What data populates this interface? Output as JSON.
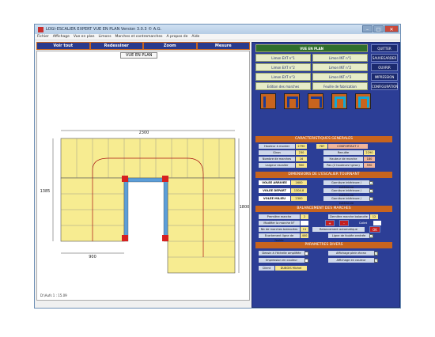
{
  "window": {
    "title": "LOGI-ESCALIER EXPERT     VUE EN PLAN     Version 3.0.3   ©   A.G.",
    "min": "–",
    "max": "□",
    "close": "✕"
  },
  "menu": [
    "Fichier",
    "Affichage",
    "Vue en plan",
    "Limons",
    "Marches et contremarches",
    "A propos de",
    "Aide"
  ],
  "toolbar": {
    "voir_tout": "Voir tout",
    "redessiner": "Redessiner",
    "zoom": "Zoom",
    "mesure": "Mesure"
  },
  "drawing": {
    "view_title": "VUE EN PLAN",
    "dim_top": "2300",
    "dim_left": "1385",
    "dim_right": "1800",
    "dim_bottom": "900",
    "status": "D:\\Aufs    1 : 15.09"
  },
  "panel": {
    "vue_en_plan": "VUE EN PLAN",
    "limon_ext_1": "Limon EXT n°1",
    "limon_int_1": "Limon INT n°1",
    "limon_ext_2": "Limon EXT n°2",
    "limon_int_2": "Limon INT n°2",
    "limon_ext_3": "Limon EXT n°3",
    "limon_int_3": "Limon INT n°3",
    "edition_marches": "Edition des marches",
    "feuille_fabrication": "Feuille de fabrication",
    "quitter": "QUITTER",
    "sauvegarder": "SAUVEGARDER",
    "ouvrir": "OUVRIR",
    "impression": "IMPRESSION",
    "configuration": "CONFIGURATION"
  },
  "caracteristiques": {
    "title": "CARACTERISTIQUES GENERALES",
    "hauteur_label": "Hauteur à monter",
    "hauteur_val": "2790",
    "ratio": "787",
    "confort": "CONFORTAUT 2",
    "giron_label": "Giron",
    "giron_val": "230",
    "recul_label": "Reculée",
    "recul_val": "2290",
    "nb_marches_label": "Nombre de marches",
    "nb_marches_val": "16",
    "haut_marche_label": "Hauteur de marche",
    "haut_marche_val": "180",
    "largeur_label": "Largeur escalier",
    "largeur_val": "900",
    "pas_label": "Pas (2 hauteurs+giron)",
    "pas_val": "590"
  },
  "dimensions": {
    "title": "DIMENSIONS DE L'ESCALIER TOURNANT",
    "volee_arrivee_label": "VOLEE ARRIVEE",
    "volee_arrivee_val": "1600",
    "volee_depart_label": "VOLEE DEPART",
    "volee_depart_val": "1304.8",
    "volee_milieu_label": "VOLEE MILIEU",
    "volee_milieu_val": "2300",
    "garniture": "Garniture intérieure / extérieure"
  },
  "balancement": {
    "title": "BALANCEMENT DES MARCHES",
    "premiere_label": "Première marche balancée",
    "premiere_val": "2",
    "derniere_label": "Dernière marche balancée",
    "derniere_val": "12",
    "modifier_label": "Modifier la marche N°",
    "modifier_val": "",
    "plus": "+",
    "moins": "-",
    "collet": "Collet",
    "nb_marches_label": "Nb de marches balancées",
    "nb_marches_val": "11",
    "auto_label": "Balancement automatique",
    "ok": "OK",
    "ecart_label": "Ecartement ligne de foulée",
    "ecart_val": "400",
    "ligne_label": "Ligne de foulée centrée"
  },
  "parametres": {
    "title": "PARAMETRES DIVERS",
    "dessin_label": "Dessin à l'échelle amplifiée",
    "affichage_label": "Affichage plein écran",
    "impression_label": "Impression en couleur",
    "affichage_couleur_label": "Affichage en couleur",
    "client_label": "Client",
    "client_val": "DUBOIS Michel"
  }
}
